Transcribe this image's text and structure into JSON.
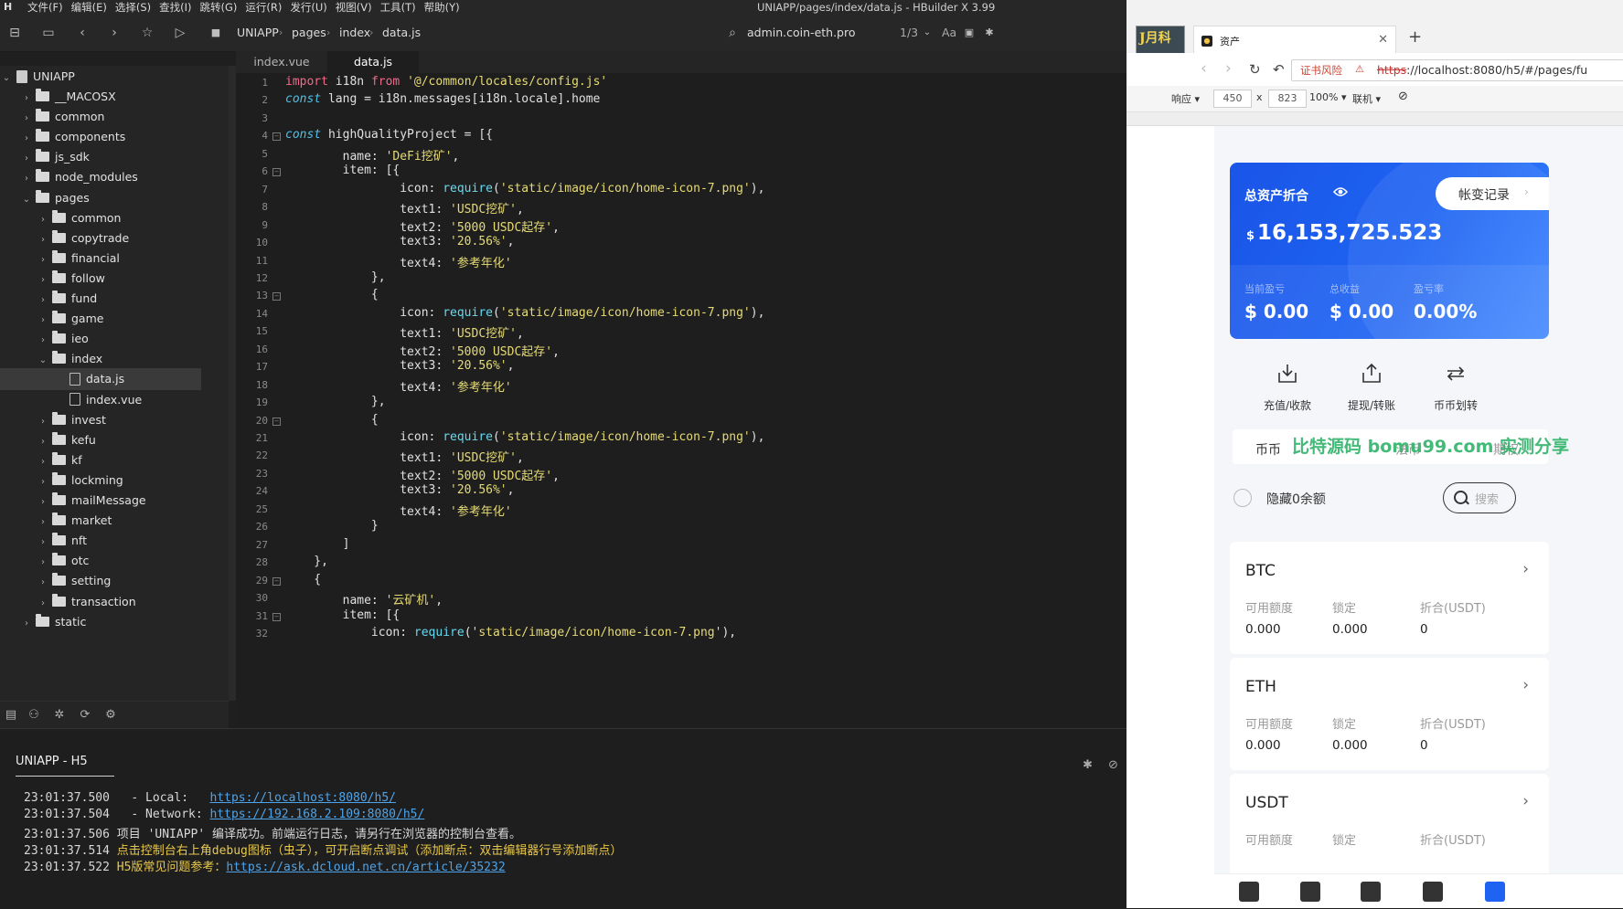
{
  "menubar": {
    "logo": "H",
    "items": [
      "文件(F)",
      "编辑(E)",
      "选择(S)",
      "查找(I)",
      "跳转(G)",
      "运行(R)",
      "发行(U)",
      "视图(V)",
      "工具(T)",
      "帮助(Y)"
    ],
    "window_title": "UNIAPP/pages/index/data.js - HBuilder X 3.99"
  },
  "toolbar": {
    "breadcrumb": [
      "UNIAPP",
      "pages",
      "index",
      "data.js"
    ],
    "search_value": "admin.coin-eth.pro",
    "page_counter": "1/3",
    "case_label": "Aa"
  },
  "sidebar": {
    "root": "UNIAPP",
    "items": [
      {
        "label": "__MACOSX",
        "level": 1,
        "type": "folder",
        "open": false
      },
      {
        "label": "common",
        "level": 1,
        "type": "folder",
        "open": false
      },
      {
        "label": "components",
        "level": 1,
        "type": "folder",
        "open": false
      },
      {
        "label": "js_sdk",
        "level": 1,
        "type": "folder",
        "open": false
      },
      {
        "label": "node_modules",
        "level": 1,
        "type": "folder",
        "open": false
      },
      {
        "label": "pages",
        "level": 1,
        "type": "folder",
        "open": true
      },
      {
        "label": "common",
        "level": 2,
        "type": "folder",
        "open": false
      },
      {
        "label": "copytrade",
        "level": 2,
        "type": "folder",
        "open": false
      },
      {
        "label": "financial",
        "level": 2,
        "type": "folder",
        "open": false
      },
      {
        "label": "follow",
        "level": 2,
        "type": "folder",
        "open": false
      },
      {
        "label": "fund",
        "level": 2,
        "type": "folder",
        "open": false
      },
      {
        "label": "game",
        "level": 2,
        "type": "folder",
        "open": false
      },
      {
        "label": "ieo",
        "level": 2,
        "type": "folder",
        "open": false
      },
      {
        "label": "index",
        "level": 2,
        "type": "folder",
        "open": true
      },
      {
        "label": "data.js",
        "level": 3,
        "type": "file",
        "selected": true
      },
      {
        "label": "index.vue",
        "level": 3,
        "type": "file"
      },
      {
        "label": "invest",
        "level": 2,
        "type": "folder",
        "open": false
      },
      {
        "label": "kefu",
        "level": 2,
        "type": "folder",
        "open": false
      },
      {
        "label": "kf",
        "level": 2,
        "type": "folder",
        "open": false
      },
      {
        "label": "lockming",
        "level": 2,
        "type": "folder",
        "open": false
      },
      {
        "label": "mailMessage",
        "level": 2,
        "type": "folder",
        "open": false
      },
      {
        "label": "market",
        "level": 2,
        "type": "folder",
        "open": false
      },
      {
        "label": "nft",
        "level": 2,
        "type": "folder",
        "open": false
      },
      {
        "label": "otc",
        "level": 2,
        "type": "folder",
        "open": false
      },
      {
        "label": "setting",
        "level": 2,
        "type": "folder",
        "open": false
      },
      {
        "label": "transaction",
        "level": 2,
        "type": "folder",
        "open": false
      },
      {
        "label": "static",
        "level": 1,
        "type": "folder",
        "open": false
      }
    ]
  },
  "editor": {
    "tabs": [
      {
        "label": "index.vue",
        "active": false
      },
      {
        "label": "data.js",
        "active": true
      }
    ],
    "lines": [
      {
        "n": "1",
        "fold": false,
        "code": "<span class=\"kw\">import</span> i18n <span class=\"kw\">from</span> <span class=\"str\">'@/common/locales/config.js'</span>"
      },
      {
        "n": "2",
        "fold": false,
        "code": "<span class=\"kwi\">const</span> lang = i18n.messages[i18n.locale].home"
      },
      {
        "n": "3",
        "fold": false,
        "code": ""
      },
      {
        "n": "4",
        "fold": true,
        "code": "<span class=\"kwi\">const</span> highQualityProject = [{"
      },
      {
        "n": "5",
        "fold": false,
        "code": "        name: <span class=\"str\">'DeFi挖矿'</span>,"
      },
      {
        "n": "6",
        "fold": true,
        "code": "        item: [{"
      },
      {
        "n": "7",
        "fold": false,
        "code": "                icon: <span class=\"fn\">require</span>(<span class=\"str\">'static/image/icon/home-icon-7.png'</span>),"
      },
      {
        "n": "8",
        "fold": false,
        "code": "                text1: <span class=\"str\">'USDC挖矿'</span>,"
      },
      {
        "n": "9",
        "fold": false,
        "code": "                text2: <span class=\"str\">'5000 USDC起存'</span>,"
      },
      {
        "n": "10",
        "fold": false,
        "code": "                text3: <span class=\"str\">'20.56%'</span>,"
      },
      {
        "n": "11",
        "fold": false,
        "code": "                text4: <span class=\"str\">'参考年化'</span>"
      },
      {
        "n": "12",
        "fold": false,
        "code": "            },"
      },
      {
        "n": "13",
        "fold": true,
        "code": "            {"
      },
      {
        "n": "14",
        "fold": false,
        "code": "                icon: <span class=\"fn\">require</span>(<span class=\"str\">'static/image/icon/home-icon-7.png'</span>),"
      },
      {
        "n": "15",
        "fold": false,
        "code": "                text1: <span class=\"str\">'USDC挖矿'</span>,"
      },
      {
        "n": "16",
        "fold": false,
        "code": "                text2: <span class=\"str\">'5000 USDC起存'</span>,"
      },
      {
        "n": "17",
        "fold": false,
        "code": "                text3: <span class=\"str\">'20.56%'</span>,"
      },
      {
        "n": "18",
        "fold": false,
        "code": "                text4: <span class=\"str\">'参考年化'</span>"
      },
      {
        "n": "19",
        "fold": false,
        "code": "            },"
      },
      {
        "n": "20",
        "fold": true,
        "code": "            {"
      },
      {
        "n": "21",
        "fold": false,
        "code": "                icon: <span class=\"fn\">require</span>(<span class=\"str\">'static/image/icon/home-icon-7.png'</span>),"
      },
      {
        "n": "22",
        "fold": false,
        "code": "                text1: <span class=\"str\">'USDC挖矿'</span>,"
      },
      {
        "n": "23",
        "fold": false,
        "code": "                text2: <span class=\"str\">'5000 USDC起存'</span>,"
      },
      {
        "n": "24",
        "fold": false,
        "code": "                text3: <span class=\"str\">'20.56%'</span>,"
      },
      {
        "n": "25",
        "fold": false,
        "code": "                text4: <span class=\"str\">'参考年化'</span>"
      },
      {
        "n": "26",
        "fold": false,
        "code": "            }"
      },
      {
        "n": "27",
        "fold": false,
        "code": "        ]"
      },
      {
        "n": "28",
        "fold": false,
        "code": "    },"
      },
      {
        "n": "29",
        "fold": true,
        "code": "    {"
      },
      {
        "n": "30",
        "fold": false,
        "code": "        name: <span class=\"str\">'云矿机'</span>,"
      },
      {
        "n": "31",
        "fold": true,
        "code": "        item: [{"
      },
      {
        "n": "32",
        "fold": false,
        "code": "            icon: <span class=\"fn\">require</span>(<span class=\"str\">'static/image/icon/home-icon-7.png'</span>),"
      }
    ]
  },
  "console": {
    "title": "UNIAPP - H5",
    "logs": [
      {
        "time": "23:01:37.500",
        "text": "  - Local:   ",
        "link": "https://localhost:8080/h5/",
        "warn": false
      },
      {
        "time": "23:01:37.504",
        "text": "  - Network: ",
        "link": "https://192.168.2.109:8080/h5/",
        "warn": false
      },
      {
        "time": "23:01:37.506",
        "text": "项目 'UNIAPP' 编译成功。前端运行日志，请另行在浏览器的控制台查看。",
        "link": "",
        "warn": false
      },
      {
        "time": "23:01:37.514",
        "text": "点击控制台右上角debug图标（虫子），可开启断点调试（添加断点：双击编辑器行号添加断点）",
        "link": "",
        "warn": true
      },
      {
        "time": "23:01:37.522",
        "text": "H5版常见问题参考：",
        "link": "https://ask.dcloud.net.cn/article/35232",
        "warn": true
      }
    ]
  },
  "browser": {
    "thumb_text": "J月科",
    "tab_title": "资产",
    "cert_warning": "证书风险",
    "url_scheme": "https",
    "url_rest": "://localhost:8080/h5/#/pages/fu",
    "device": {
      "mode": "响应",
      "width": "450",
      "times": "x",
      "height": "823",
      "zoom": "100%",
      "network": "联机"
    }
  },
  "app": {
    "asset_title": "总资产折合",
    "history_label": "帐变记录",
    "history_arrow": "›",
    "currency": "$",
    "total": "16,153,725.523",
    "stats": [
      {
        "label": "当前盈亏",
        "value": "$ 0.00"
      },
      {
        "label": "总收益",
        "value": "$ 0.00"
      },
      {
        "label": "盈亏率",
        "value": "0.00%"
      }
    ],
    "actions": [
      {
        "label": "充值/收款",
        "icon": "deposit-icon"
      },
      {
        "label": "提现/转账",
        "icon": "withdraw-icon"
      },
      {
        "label": "币币划转",
        "icon": "transfer-icon"
      }
    ],
    "coin_tabs": [
      "币币",
      "法币",
      "期权"
    ],
    "watermark": "比特源码 bomu99.com 实测分享",
    "hide_zero_label": "隐藏0余额",
    "search_placeholder": "搜索",
    "coins": [
      {
        "name": "BTC",
        "labels": [
          "可用额度",
          "锁定",
          "折合(USDT)"
        ],
        "values": [
          "0.000",
          "0.000",
          "0"
        ]
      },
      {
        "name": "ETH",
        "labels": [
          "可用额度",
          "锁定",
          "折合(USDT)"
        ],
        "values": [
          "0.000",
          "0.000",
          "0"
        ]
      },
      {
        "name": "USDT",
        "labels": [
          "可用额度",
          "锁定",
          "折合(USDT)"
        ],
        "values": []
      }
    ],
    "colors": {
      "primary": "#1e63f2",
      "watermark": "#2fb36a"
    }
  }
}
